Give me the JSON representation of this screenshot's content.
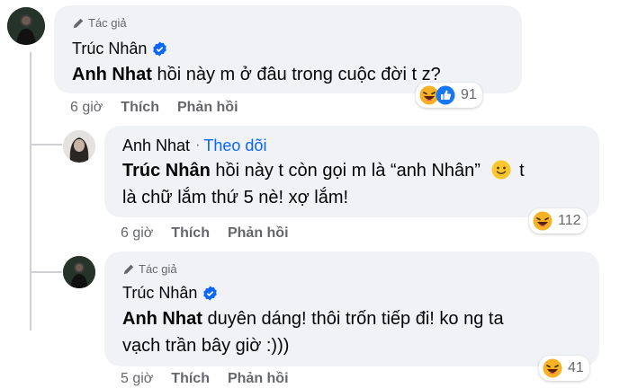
{
  "comments": [
    {
      "badge": "Tác giả",
      "name": "Trúc Nhân",
      "tag": "Anh Nhat",
      "text": " hồi này m ở đâu trong cuộc đời t z?",
      "time": "6 giờ",
      "like": "Thích",
      "reply": "Phản hồi",
      "reaction_count": "91"
    },
    {
      "name": "Anh Nhat",
      "separator": "·",
      "follow": "Theo dõi",
      "tag": "Trúc Nhân",
      "text_line1": " hồi này t còn gọi m là “anh Nhân”",
      "text_after_emoji": "t",
      "text_line2": "là chữ lắm thứ 5 nè! xợ lắm!",
      "time": "6 giờ",
      "like": "Thích",
      "reply": "Phản hồi",
      "reaction_count": "112"
    },
    {
      "badge": "Tác giả",
      "name": "Trúc Nhân",
      "tag": "Anh Nhat",
      "text_line1": " duyên dáng! thôi trốn tiếp đi! ko ng ta",
      "text_line2": "vạch trần bây giờ :)))",
      "time": "5 giờ",
      "like": "Thích",
      "reply": "Phản hồi",
      "reaction_count": "41"
    }
  ],
  "colors": {
    "bubble": "#f0f2f5",
    "link": "#0866ff",
    "meta": "#65676b",
    "verified": "#0866ff"
  },
  "icons": [
    "pen-icon",
    "verified-badge-icon",
    "haha-emoji-icon",
    "like-reaction-icon",
    "smile-emoji-icon"
  ]
}
